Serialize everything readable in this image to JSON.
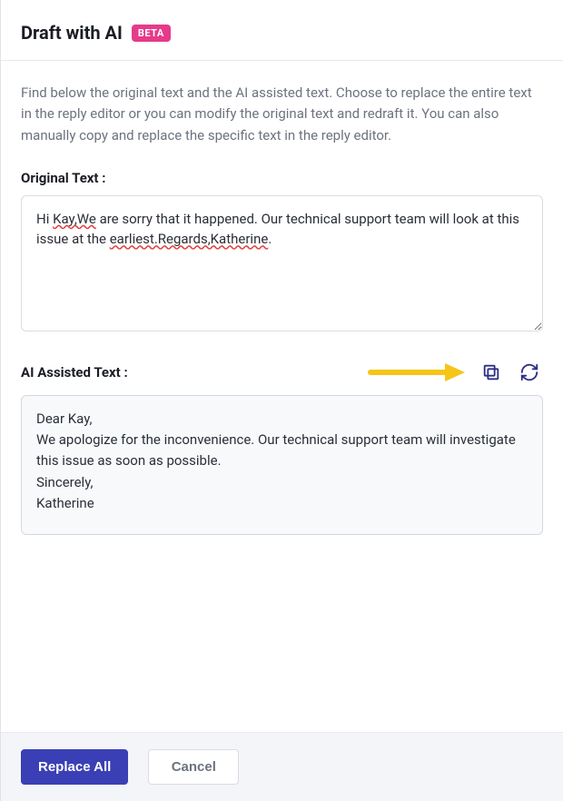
{
  "header": {
    "title": "Draft with AI",
    "badge": "BETA"
  },
  "intro": "Find below the original text and the AI assisted text. Choose to replace the entire text in the reply editor or you can modify the original text and redraft it. You can also manually copy and replace the specific text in the reply editor.",
  "original": {
    "label": "Original Text :",
    "segments": [
      {
        "t": "Hi ",
        "err": false
      },
      {
        "t": "Kay,We",
        "err": true
      },
      {
        "t": " are sorry that it happened. Our technical support team will look at this issue at the ",
        "err": false
      },
      {
        "t": "earliest.Regards,Katherine",
        "err": true
      },
      {
        "t": ".",
        "err": false
      }
    ]
  },
  "ai": {
    "label": "AI Assisted Text :",
    "text": "Dear Kay,\nWe apologize for the inconvenience. Our technical support team will investigate this issue as soon as possible.\nSincerely,\nKatherine"
  },
  "icons": {
    "copy": "copy-icon",
    "refresh": "refresh-icon"
  },
  "annotation": {
    "arrow_color": "#f5c518"
  },
  "footer": {
    "replace_all": "Replace All",
    "cancel": "Cancel"
  },
  "colors": {
    "primary": "#3a3fb5",
    "badge": "#e53b8a",
    "icon": "#2a2f86"
  }
}
